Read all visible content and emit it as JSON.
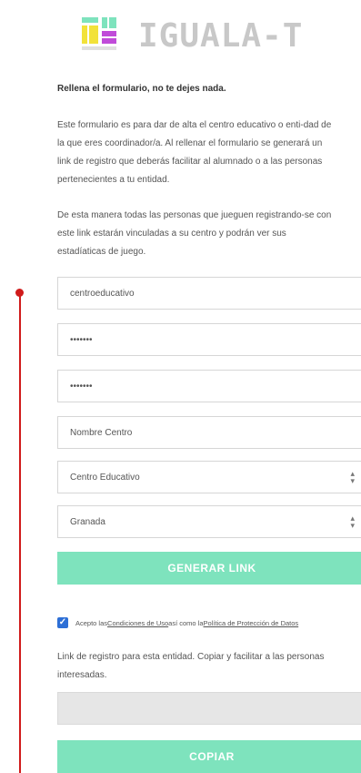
{
  "logo": {
    "text": "IGUALA-T"
  },
  "instructions": {
    "heading": "Rellena el formulario, no te dejes nada.",
    "para1": [
      "Este formulario es para dar de alta el centro educativo o enti-dad de",
      "la que eres coordinador/a. Al rellenar el formulario se generará un",
      "link de registro que deberás facilitar al alumnado o a las personas",
      "pertenecientes a tu entidad."
    ],
    "para2": [
      "De esta manera todas las personas que jueguen registrando-se con",
      "este link estarán vinculadas a su centro y podrán ver sus",
      "estadíaticas de juego."
    ]
  },
  "form": {
    "username": "centroeducativo",
    "password": "•••••••",
    "password_confirm": "•••••••",
    "center_name": "Nombre Centro",
    "center_type": "Centro Educativo",
    "province": "Granada",
    "generate_label": "GENERAR LINK"
  },
  "consent": {
    "prefix": "Acepto las ",
    "terms_link": "Condiciones de Uso",
    "middle": " así como la ",
    "privacy_link": "Política de Protección de Datos"
  },
  "link_section": {
    "text": [
      "Link de registro para esta entidad. Copiar y facilitar a las personas",
      "interesadas."
    ],
    "link_value": "",
    "copy_label": "COPIAR"
  },
  "colors": {
    "accent": "#7ee3bd",
    "timeline": "#d01b1b",
    "checkbox": "#2d6fd6"
  }
}
